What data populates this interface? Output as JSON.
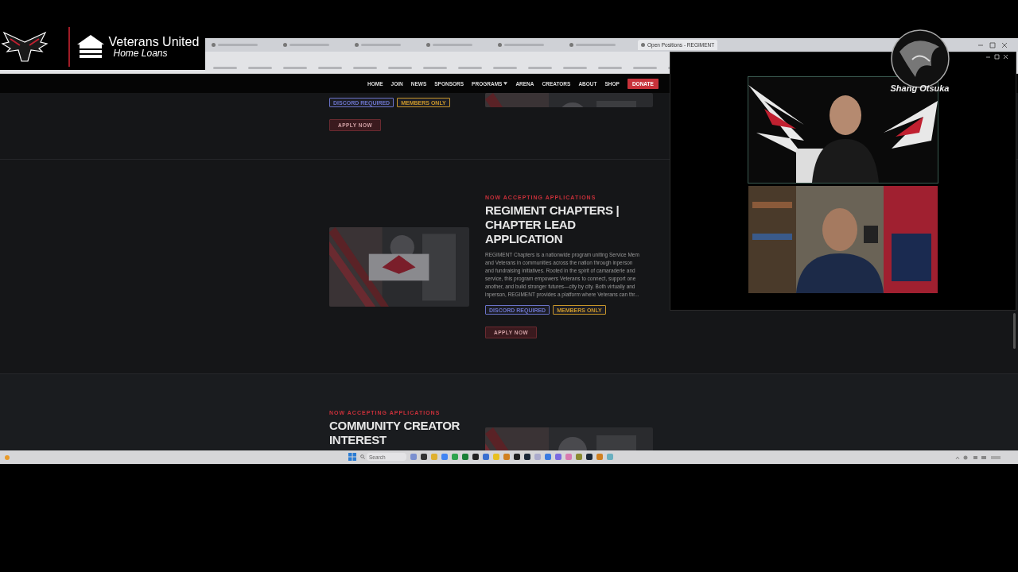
{
  "sponsor_logo": {
    "name": "Veterans United",
    "subtitle": "Home Loans"
  },
  "streamer_logo": {
    "name": "Shang Otsuka"
  },
  "browser": {
    "tabs": [
      {
        "selected": false
      },
      {
        "selected": false
      },
      {
        "selected": false
      },
      {
        "selected": false
      },
      {
        "selected": false
      },
      {
        "selected": false
      },
      {
        "title": "Open Positions - REGIMENT",
        "selected": true
      }
    ]
  },
  "nav": [
    {
      "label": "HOME",
      "kind": "link"
    },
    {
      "label": "JOIN",
      "kind": "link"
    },
    {
      "label": "NEWS",
      "kind": "link"
    },
    {
      "label": "SPONSORS",
      "kind": "link"
    },
    {
      "label": "PROGRAMS",
      "kind": "menu"
    },
    {
      "label": "ARENA",
      "kind": "link"
    },
    {
      "label": "CREATORS",
      "kind": "link"
    },
    {
      "label": "ABOUT",
      "kind": "link"
    },
    {
      "label": "SHOP",
      "kind": "link"
    },
    {
      "label": "DONATE",
      "kind": "button"
    }
  ],
  "sections": [
    {
      "image": {
        "kind": "picture"
      },
      "tags": [
        {
          "label": "DISCORD REQUIRED",
          "color": "#6a72c8"
        },
        {
          "label": "MEMBERS ONLY",
          "color": "#c8962a"
        }
      ],
      "button": "APPLY NOW"
    },
    {
      "image": {
        "kind": "picture"
      },
      "eyebrow": "NOW ACCEPTING APPLICATIONS",
      "title": "REGIMENT CHAPTERS | CHAPTER LEAD APPLICATION",
      "description": [
        "REGIMENT Chapters is a nationwide program uniting Service Mem",
        "and Veterans in communities across the nation through inperson",
        "and fundraising initiatives. Rooted in the spirit of camaraderie and",
        "service, this program empowers Veterans to connect, support one",
        "another, and build stronger futures—city by city. Both virtually and",
        "inperson, REGIMENT provides a platform where Veterans can thr..."
      ],
      "tags": [
        {
          "label": "DISCORD REQUIRED",
          "color": "#6a72c8"
        },
        {
          "label": "MEMBERS ONLY",
          "color": "#c8962a"
        }
      ],
      "button": "APPLY NOW"
    },
    {
      "image": {
        "kind": "picture"
      },
      "eyebrow": "NOW ACCEPTING APPLICATIONS",
      "title": "COMMUNITY CREATOR INTEREST"
    }
  ],
  "taskbar": {
    "search": {
      "placeholder": "Search"
    }
  }
}
